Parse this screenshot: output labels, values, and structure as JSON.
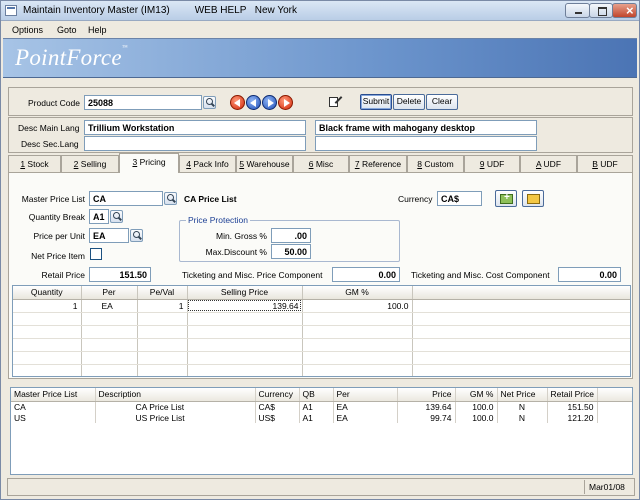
{
  "window": {
    "title": "Maintain Inventory Master (IM13)",
    "web_help": "WEB HELP",
    "location": "New York"
  },
  "menu": [
    "Options",
    "Goto",
    "Help"
  ],
  "banner": {
    "logo": "PointForce",
    "logo_mark": "™"
  },
  "header": {
    "product_code_label": "Product Code",
    "product_code": "25088",
    "submit_label": "Submit",
    "delete_label": "Delete",
    "clear_label": "Clear",
    "desc_main_label": "Desc Main Lang",
    "desc_main_1": "Trillium Workstation",
    "desc_main_2": "Black frame with mahogany desktop",
    "desc_sec_label": "Desc Sec.Lang",
    "desc_sec_1": "",
    "desc_sec_2": ""
  },
  "tabs": [
    {
      "num": "1",
      "label": "Stock"
    },
    {
      "num": "2",
      "label": "Selling"
    },
    {
      "num": "3",
      "label": "Pricing"
    },
    {
      "num": "4",
      "label": "Pack Info"
    },
    {
      "num": "5",
      "label": "Warehouse"
    },
    {
      "num": "6",
      "label": "Misc"
    },
    {
      "num": "7",
      "label": "Reference"
    },
    {
      "num": "8",
      "label": "Custom"
    },
    {
      "num": "9",
      "label": "UDF"
    },
    {
      "num": "A",
      "label": "UDF"
    },
    {
      "num": "B",
      "label": "UDF"
    }
  ],
  "pricing": {
    "master_price_list_label": "Master Price List",
    "master_price_list": "CA",
    "master_price_list_desc": "CA Price List",
    "currency_label": "Currency",
    "currency": "CA$",
    "quantity_break_label": "Quantity Break",
    "quantity_break": "A1",
    "price_per_unit_label": "Price per Unit",
    "price_per_unit": "EA",
    "net_price_item_label": "Net Price Item",
    "retail_price_label": "Retail Price",
    "retail_price": "151.50",
    "protection_legend": "Price Protection",
    "min_gross_label": "Min. Gross %",
    "min_gross": ".00",
    "max_discount_label": "Max.Discount %",
    "max_discount": "50.00",
    "ticketing_price_label": "Ticketing and Misc. Price Component",
    "ticketing_price": "0.00",
    "ticketing_cost_label": "Ticketing and Misc. Cost Component",
    "ticketing_cost": "0.00"
  },
  "price_grid": {
    "headers": [
      "Quantity",
      "Per",
      "Pe/Val",
      "Selling Price",
      "GM %"
    ],
    "rows": [
      [
        "1",
        "EA",
        "1",
        "139.64",
        "100.0"
      ]
    ]
  },
  "price_lists": {
    "headers": [
      "Master Price List",
      "Description",
      "Currency",
      "QB",
      "Per",
      "Price",
      "GM %",
      "Net Price",
      "Retail Price"
    ],
    "rows": [
      [
        "CA",
        "CA Price List",
        "CA$",
        "A1",
        "EA",
        "139.64",
        "100.0",
        "N",
        "151.50"
      ],
      [
        "US",
        "US Price List",
        "US$",
        "A1",
        "EA",
        "99.74",
        "100.0",
        "N",
        "121.20"
      ]
    ]
  },
  "status": {
    "date": "Mar01/08"
  }
}
